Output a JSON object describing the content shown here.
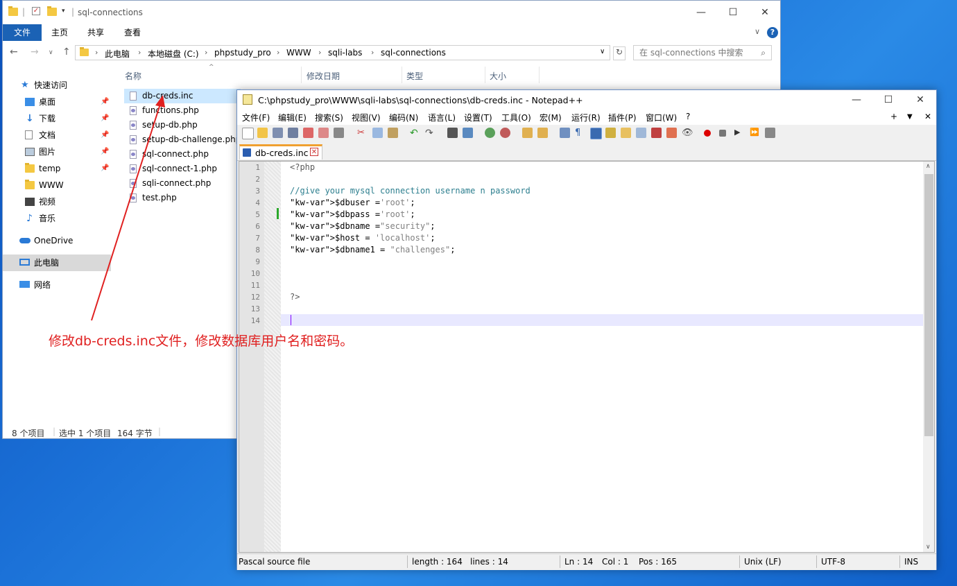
{
  "explorer": {
    "title": "sql-connections",
    "ribbon_tabs": [
      "文件",
      "主页",
      "共享",
      "查看"
    ],
    "breadcrumbs": [
      "此电脑",
      "本地磁盘 (C:)",
      "phpstudy_pro",
      "WWW",
      "sqli-labs",
      "sql-connections"
    ],
    "search_placeholder": "在 sql-connections 中搜索",
    "columns": [
      "名称",
      "修改日期",
      "类型",
      "大小"
    ],
    "sidebar": [
      {
        "label": "快速访问",
        "icon": "star-icon",
        "pinned": false
      },
      {
        "label": "桌面",
        "icon": "desktop-icon",
        "pinned": true
      },
      {
        "label": "下载",
        "icon": "download-icon",
        "pinned": true
      },
      {
        "label": "文档",
        "icon": "document-icon",
        "pinned": true
      },
      {
        "label": "图片",
        "icon": "picture-icon",
        "pinned": true
      },
      {
        "label": "temp",
        "icon": "folder-icon",
        "pinned": true
      },
      {
        "label": "WWW",
        "icon": "folder-icon",
        "pinned": false
      },
      {
        "label": "视频",
        "icon": "video-icon",
        "pinned": false
      },
      {
        "label": "音乐",
        "icon": "music-icon",
        "pinned": false
      },
      {
        "label": "OneDrive",
        "icon": "cloud-icon",
        "pinned": false
      },
      {
        "label": "此电脑",
        "icon": "computer-icon",
        "pinned": false
      },
      {
        "label": "网络",
        "icon": "network-icon",
        "pinned": false
      }
    ],
    "files": [
      {
        "name": "db-creds.inc",
        "type": "inc",
        "selected": true
      },
      {
        "name": "functions.php",
        "type": "php"
      },
      {
        "name": "setup-db.php",
        "type": "php"
      },
      {
        "name": "setup-db-challenge.php",
        "type": "php"
      },
      {
        "name": "sql-connect.php",
        "type": "php"
      },
      {
        "name": "sql-connect-1.php",
        "type": "php"
      },
      {
        "name": "sqli-connect.php",
        "type": "php"
      },
      {
        "name": "test.php",
        "type": "php"
      }
    ],
    "status": {
      "count": "8 个项目",
      "selected": "选中 1 个项目",
      "size": "164 字节"
    }
  },
  "notepad": {
    "title": "C:\\phpstudy_pro\\WWW\\sqli-labs\\sql-connections\\db-creds.inc - Notepad++",
    "menu": [
      "文件(F)",
      "编辑(E)",
      "搜索(S)",
      "视图(V)",
      "编码(N)",
      "语言(L)",
      "设置(T)",
      "工具(O)",
      "宏(M)",
      "运行(R)",
      "插件(P)",
      "窗口(W)",
      "?"
    ],
    "menu_right": [
      "+",
      "▼",
      "✕"
    ],
    "tab": "db-creds.inc",
    "lines": [
      {
        "n": "1",
        "text": "<?php"
      },
      {
        "n": "2",
        "text": ""
      },
      {
        "n": "3",
        "text": "//give your mysql connection username n password"
      },
      {
        "n": "4",
        "text": "$dbuser ='root';"
      },
      {
        "n": "5",
        "text": "$dbpass ='root';"
      },
      {
        "n": "6",
        "text": "$dbname =\"security\";"
      },
      {
        "n": "7",
        "text": "$host = 'localhost';"
      },
      {
        "n": "8",
        "text": "$dbname1 = \"challenges\";"
      },
      {
        "n": "9",
        "text": ""
      },
      {
        "n": "10",
        "text": ""
      },
      {
        "n": "11",
        "text": ""
      },
      {
        "n": "12",
        "text": "?>"
      },
      {
        "n": "13",
        "text": ""
      },
      {
        "n": "14",
        "text": ""
      }
    ],
    "status": {
      "file_type": "Pascal source file",
      "length": "length : 164",
      "lines": "lines : 14",
      "ln": "Ln : 14",
      "col": "Col : 1",
      "pos": "Pos : 165",
      "eol": "Unix (LF)",
      "encoding": "UTF-8",
      "mode": "INS"
    }
  },
  "annotation": "修改db-creds.inc文件，修改数据库用户名和密码。",
  "colors": {
    "accent": "#1b62b5",
    "annotation": "#e02020",
    "selection": "#cce8ff"
  }
}
